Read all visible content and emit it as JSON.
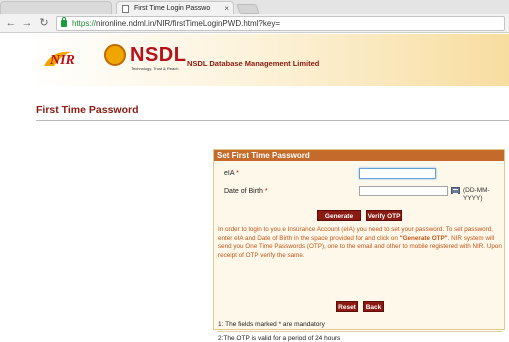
{
  "browser": {
    "tab_title": "First Time Login Passwo",
    "tab_close": "×",
    "url_protocol": "https://",
    "url_rest": "nironline.ndml.in/NIR/firstTimeLoginPWD.html?key=",
    "back_icon": "←",
    "forward_icon": "→",
    "reload_icon": "↻"
  },
  "header": {
    "nir_logo_text": "NIR",
    "nsdl_logo_text": "NSDL",
    "nsdl_tagline": "Technology, Trust & Reach",
    "company_name": "NSDL Database Management Limited"
  },
  "page": {
    "title": "First Time Password"
  },
  "form": {
    "heading": "Set First Time Password",
    "eia_label": "eIA",
    "eia_value": "",
    "dob_label": "Date of Birth",
    "dob_value": "",
    "required_mark": "*",
    "dob_format": "(DD-MM-YYYY)",
    "generate_otp_label": "Generate OTP",
    "verify_otp_label": "Verify OTP",
    "info_part1": "In order to login to you e Insurance Account (eIA) you need to set your password. To set password, enter eIA and Date of Birth in the space provided for and click on ",
    "info_strong": "\"Generate OTP\"",
    "info_part2": ". NIR system will send you One Time Passwords (OTP), one to the email and other to mobile registered with NIR. Upon receipt of OTP verify the same.",
    "reset_label": "Reset",
    "back_label": "Back",
    "note1": "1: The fields marked * are mandatory",
    "note2": "2:The OTP is valid for a period of 24 hours"
  },
  "colors": {
    "brand_maroon": "#8a1a12",
    "panel_header": "#c46a2a",
    "info_text": "#c2561a",
    "secure_green": "#1a9c3a"
  }
}
